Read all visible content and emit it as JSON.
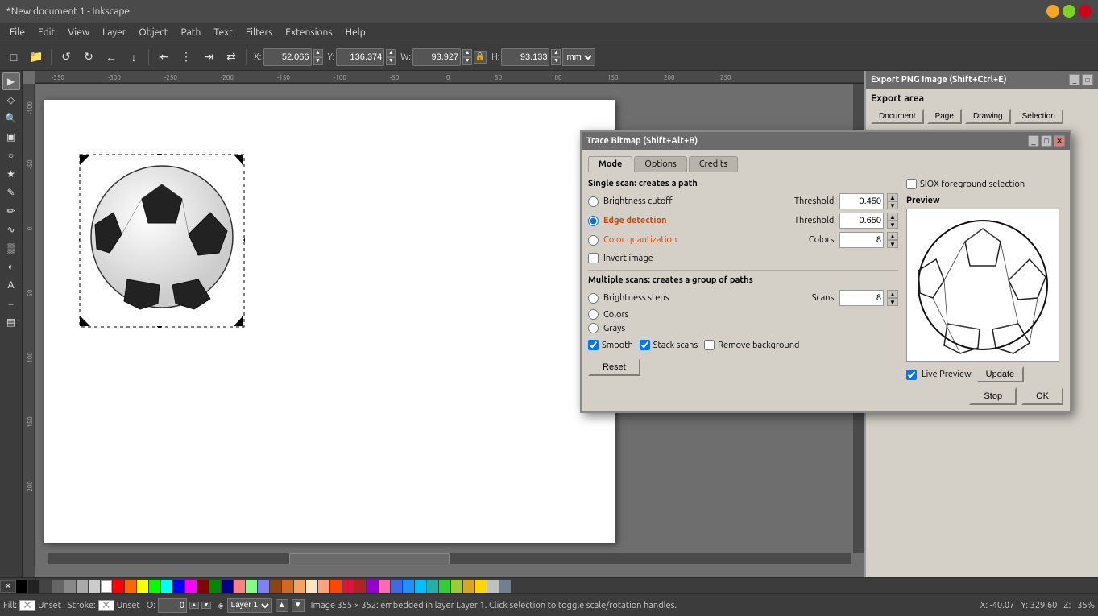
{
  "app": {
    "title": "*New document 1 - Inkscape",
    "title_prefix": "*New document 1 - Inkscape"
  },
  "menubar": {
    "items": [
      "File",
      "Edit",
      "View",
      "Layer",
      "Object",
      "Path",
      "Text",
      "Filters",
      "Extensions",
      "Help"
    ]
  },
  "toolbar": {
    "coords": {
      "x_label": "X:",
      "x_value": "52.066",
      "y_label": "Y:",
      "y_value": "136.374",
      "w_label": "W:",
      "w_value": "93.927",
      "h_label": "H:",
      "h_value": "93.133",
      "unit": "mm"
    }
  },
  "trace_dialog": {
    "title": "Trace Bitmap (Shift+Alt+B)",
    "tabs": [
      "Mode",
      "Options",
      "Credits"
    ],
    "active_tab": "Mode",
    "single_scan_label": "Single scan: creates a path",
    "options": [
      {
        "id": "brightness",
        "label": "Brightness cutoff",
        "checked": false
      },
      {
        "id": "edge",
        "label": "Edge detection",
        "checked": true,
        "color": "normal"
      },
      {
        "id": "color_quant",
        "label": "Color quantization",
        "checked": false,
        "color": "orange"
      }
    ],
    "brightness_threshold_label": "Threshold:",
    "brightness_threshold_value": "0.450",
    "edge_threshold_label": "Threshold:",
    "edge_threshold_value": "0.650",
    "colors_label": "Colors:",
    "colors_value": "8",
    "invert_label": "Invert image",
    "invert_checked": false,
    "multiple_scan_label": "Multiple scans: creates a group of paths",
    "multiple_options": [
      {
        "id": "brightness_steps",
        "label": "Brightness steps",
        "checked": false
      },
      {
        "id": "colors_multi",
        "label": "Colors",
        "checked": false
      },
      {
        "id": "grays",
        "label": "Grays",
        "checked": false
      }
    ],
    "scans_label": "Scans:",
    "scans_value": "8",
    "smooth_label": "Smooth",
    "smooth_checked": true,
    "stack_scans_label": "Stack scans",
    "stack_scans_checked": true,
    "remove_bg_label": "Remove background",
    "remove_bg_checked": false,
    "siox_label": "SIOX foreground selection",
    "siox_checked": false,
    "preview_label": "Preview",
    "live_preview_label": "Live Preview",
    "live_preview_checked": true,
    "update_btn": "Update",
    "reset_btn": "Reset",
    "stop_btn": "Stop",
    "ok_btn": "OK"
  },
  "export_panel": {
    "title": "Export PNG Image (Shift+Ctrl+E)",
    "export_area_label": "Export area"
  },
  "status_bar": {
    "fill_label": "Fill:",
    "fill_value": "Unset",
    "stroke_label": "Stroke:",
    "stroke_value": "Unset",
    "opacity_label": "O:",
    "opacity_value": "0",
    "layer_label": "Layer 1",
    "status_text": "Image 355 × 352: embedded in layer Layer 1. Click selection to toggle scale/rotation handles.",
    "x_coord": "X: -40.07",
    "y_coord": "Y: 329.60",
    "zoom_label": "Z:",
    "zoom_value": "35%"
  },
  "colors": {
    "dialog_bg": "#d4d0c8",
    "dialog_title_bg": "#6b6b6b",
    "canvas_bg": "#6e6e6e",
    "toolbar_bg": "#3c3c3c",
    "edge_detection_color": "#cc4400"
  }
}
